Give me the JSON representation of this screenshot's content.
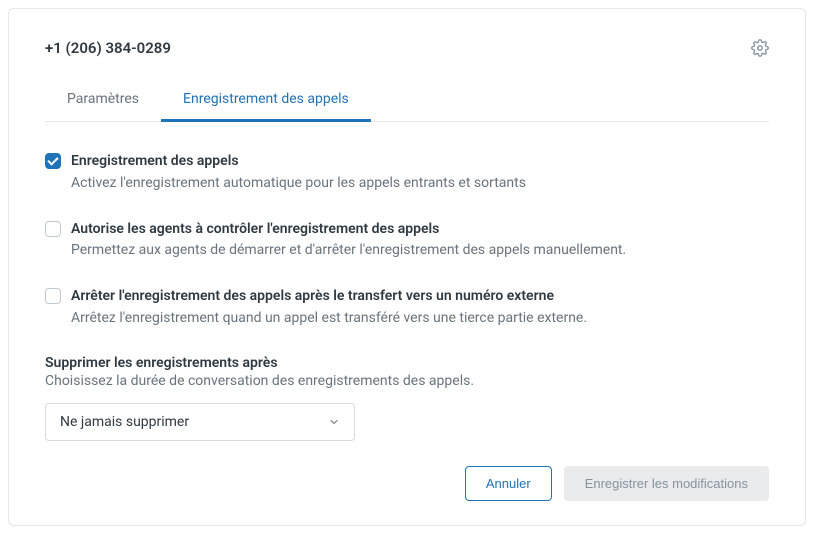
{
  "header": {
    "phone_number": "+1 (206) 384-0289"
  },
  "tabs": {
    "settings": "Paramètres",
    "recording": "Enregistrement des appels"
  },
  "options": {
    "call_recording": {
      "title": "Enregistrement des appels",
      "desc": "Activez l'enregistrement automatique pour les appels entrants et sortants"
    },
    "agent_control": {
      "title": "Autorise les agents à contrôler l'enregistrement des appels",
      "desc": "Permettez aux agents de démarrer et d'arrêter l'enregistrement des appels manuellement."
    },
    "stop_after_transfer": {
      "title": "Arrêter l'enregistrement des appels après le transfert vers un numéro externe",
      "desc": "Arrêtez l'enregistrement quand un appel est transféré vers une tierce partie externe."
    }
  },
  "delete_section": {
    "title": "Supprimer les enregistrements après",
    "desc": "Choisissez la durée de conversation des enregistrements des appels.",
    "selected": "Ne jamais supprimer"
  },
  "buttons": {
    "cancel": "Annuler",
    "save": "Enregistrer les modifications"
  }
}
